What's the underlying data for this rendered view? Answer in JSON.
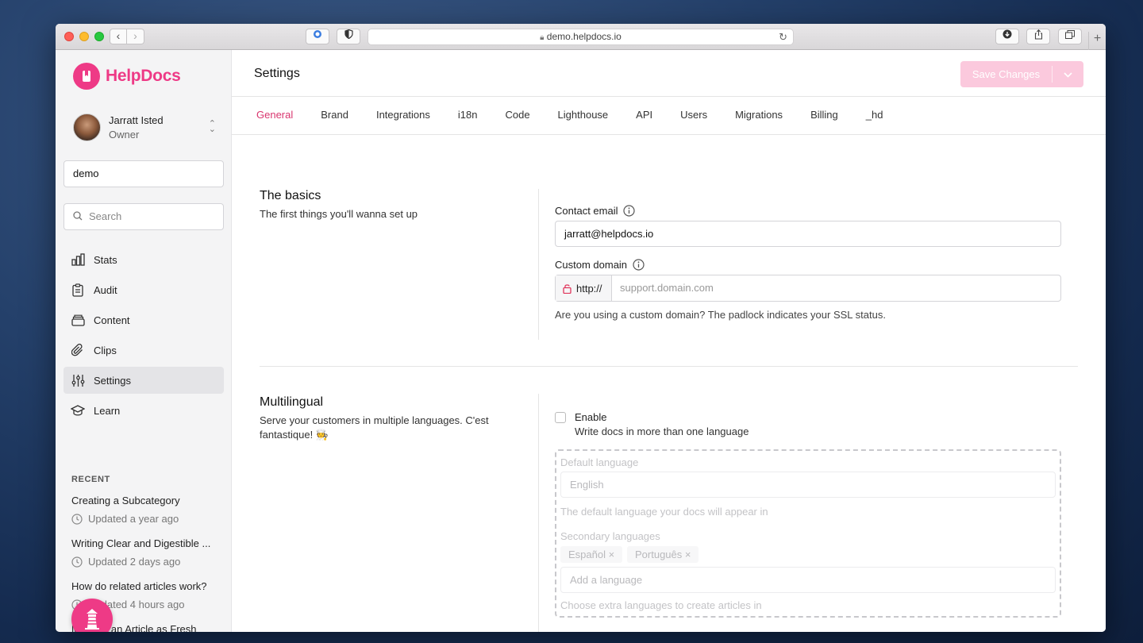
{
  "browser": {
    "url": "demo.helpdocs.io",
    "back": "‹",
    "forward": "›"
  },
  "brand": {
    "name": "HelpDocs",
    "color": "#ee3a86"
  },
  "user": {
    "name": "Jarratt Isted",
    "role": "Owner"
  },
  "sidebar": {
    "org_value": "demo",
    "search_placeholder": "Search",
    "nav": [
      {
        "label": "Stats",
        "icon": "bar-chart-icon"
      },
      {
        "label": "Audit",
        "icon": "clipboard-icon"
      },
      {
        "label": "Content",
        "icon": "archive-icon"
      },
      {
        "label": "Clips",
        "icon": "paperclip-icon"
      },
      {
        "label": "Settings",
        "icon": "sliders-icon",
        "active": true
      },
      {
        "label": "Learn",
        "icon": "graduation-cap-icon"
      }
    ],
    "recent_heading": "RECENT",
    "recent": [
      {
        "title": "Creating a Subcategory",
        "time": "Updated a year ago"
      },
      {
        "title": "Writing Clear and Digestible ...",
        "time": "Updated 2 days ago"
      },
      {
        "title": "How do related articles work?",
        "time": "Updated 4 hours ago"
      },
      {
        "title": "Marking an Article as Fresh",
        "time": ""
      }
    ]
  },
  "header": {
    "title": "Settings",
    "save_label": "Save Changes"
  },
  "tabs": [
    "General",
    "Brand",
    "Integrations",
    "i18n",
    "Code",
    "Lighthouse",
    "API",
    "Users",
    "Migrations",
    "Billing",
    "_hd"
  ],
  "active_tab": "General",
  "basics": {
    "title": "The basics",
    "desc": "The first things you'll wanna set up",
    "contact_label": "Contact email",
    "contact_value": "jarratt@helpdocs.io",
    "domain_label": "Custom domain",
    "domain_prefix": "http://",
    "domain_placeholder": "support.domain.com",
    "domain_help": "Are you using a custom domain? The padlock indicates your SSL status."
  },
  "multilingual": {
    "title": "Multilingual",
    "desc": "Serve your customers in multiple languages. C'est fantastique! 🧑‍🍳",
    "enable_label": "Enable",
    "enable_help": "Write docs in more than one language",
    "enabled": false,
    "default_label": "Default language",
    "default_value": "English",
    "default_help": "The default language your docs will appear in",
    "secondary_label": "Secondary languages",
    "secondary_chips": [
      "Español ×",
      "Português ×"
    ],
    "add_placeholder": "Add a language",
    "secondary_help": "Choose extra languages to create articles in"
  }
}
